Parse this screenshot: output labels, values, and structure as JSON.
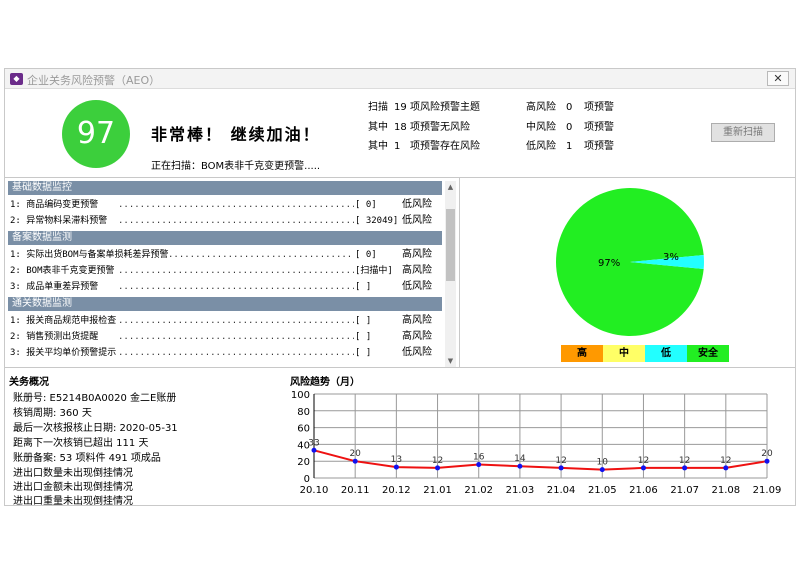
{
  "window": {
    "title": "企业关务风险预警（AEO）",
    "close_label": "✕",
    "app_icon": "app-logo-icon"
  },
  "score": {
    "value": "97",
    "praise": "非常棒！ 继续加油！",
    "color": "#3ccf3c"
  },
  "scan_status": "正在扫描：BOM表非千克变更预警.....",
  "summary": [
    {
      "a": "扫描",
      "b": "19",
      "c": "项风险预警主题",
      "d": "高风险",
      "e": "0",
      "f": "项预警"
    },
    {
      "a": "其中",
      "b": "18",
      "c": "项预警无风险",
      "d": "中风险",
      "e": "0",
      "f": "项预警"
    },
    {
      "a": "其中",
      "b": "1",
      "c": "项预警存在风险",
      "d": "低风险",
      "e": "1",
      "f": "项预警"
    }
  ],
  "rescan_label": "重新扫描",
  "sections": [
    {
      "header": "基础数据监控",
      "items": [
        {
          "name": "1: 商品编码变更预警",
          "value": "[      0]",
          "level": "低风险"
        },
        {
          "name": "2: 异常物料呆滞料预警",
          "value": "[  32049]",
          "level": "低风险"
        }
      ]
    },
    {
      "header": "备案数据监测",
      "items": [
        {
          "name": "1: 实际出货BOM与备案单损耗差异预警",
          "value": "[      0]",
          "level": "高风险"
        },
        {
          "name": "2: BOM表非千克变更预警",
          "value": "[扫描中]",
          "level": "高风险"
        },
        {
          "name": "3: 成品单重差异预警",
          "value": "[       ]",
          "level": "低风险"
        }
      ]
    },
    {
      "header": "通关数据监测",
      "items": [
        {
          "name": "1: 报关商品规范申报检查",
          "value": "[       ]",
          "level": "高风险"
        },
        {
          "name": "2: 销售预测出货提醒",
          "value": "[       ]",
          "level": "高风险"
        },
        {
          "name": "3: 报关平均单价预警提示",
          "value": "[       ]",
          "level": "低风险"
        }
      ]
    }
  ],
  "pie": {
    "safe_label": "97%",
    "low_label": "3%",
    "safe_value": 97,
    "low_value": 3,
    "safe_color": "#22ee22",
    "low_color": "#22ffff"
  },
  "legend": [
    {
      "label": "高",
      "color": "#ff9900"
    },
    {
      "label": "中",
      "color": "#ffff66"
    },
    {
      "label": "低",
      "color": "#22ffff"
    },
    {
      "label": "安全",
      "color": "#22ee22"
    }
  ],
  "info": {
    "title": "关务概况",
    "lines": [
      "账册号: E5214B0A0020  金二E账册",
      "核销周期: 360 天",
      "最后一次核报核止日期: 2020-05-31",
      "距离下一次核销已超出 111 天",
      "账册备案: 53 项料件  491 项成品",
      "进出口数量未出现倒挂情况",
      "进出口金额未出现倒挂情况",
      "进出口重量未出现倒挂情况"
    ]
  },
  "chart_data": {
    "type": "line",
    "title": "风险趋势（月）",
    "categories": [
      "20.10",
      "20.11",
      "20.12",
      "21.01",
      "21.02",
      "21.03",
      "21.04",
      "21.05",
      "21.06",
      "21.07",
      "21.08",
      "21.09"
    ],
    "values": [
      33,
      20,
      13,
      12,
      16,
      14,
      12,
      10,
      12,
      12,
      12,
      20
    ],
    "ylim": [
      0,
      100
    ],
    "yticks": [
      "0",
      "20",
      "40",
      "60",
      "80",
      "100"
    ],
    "grid": true,
    "line_color": "#ee1111",
    "point_color": "#1111ee"
  }
}
